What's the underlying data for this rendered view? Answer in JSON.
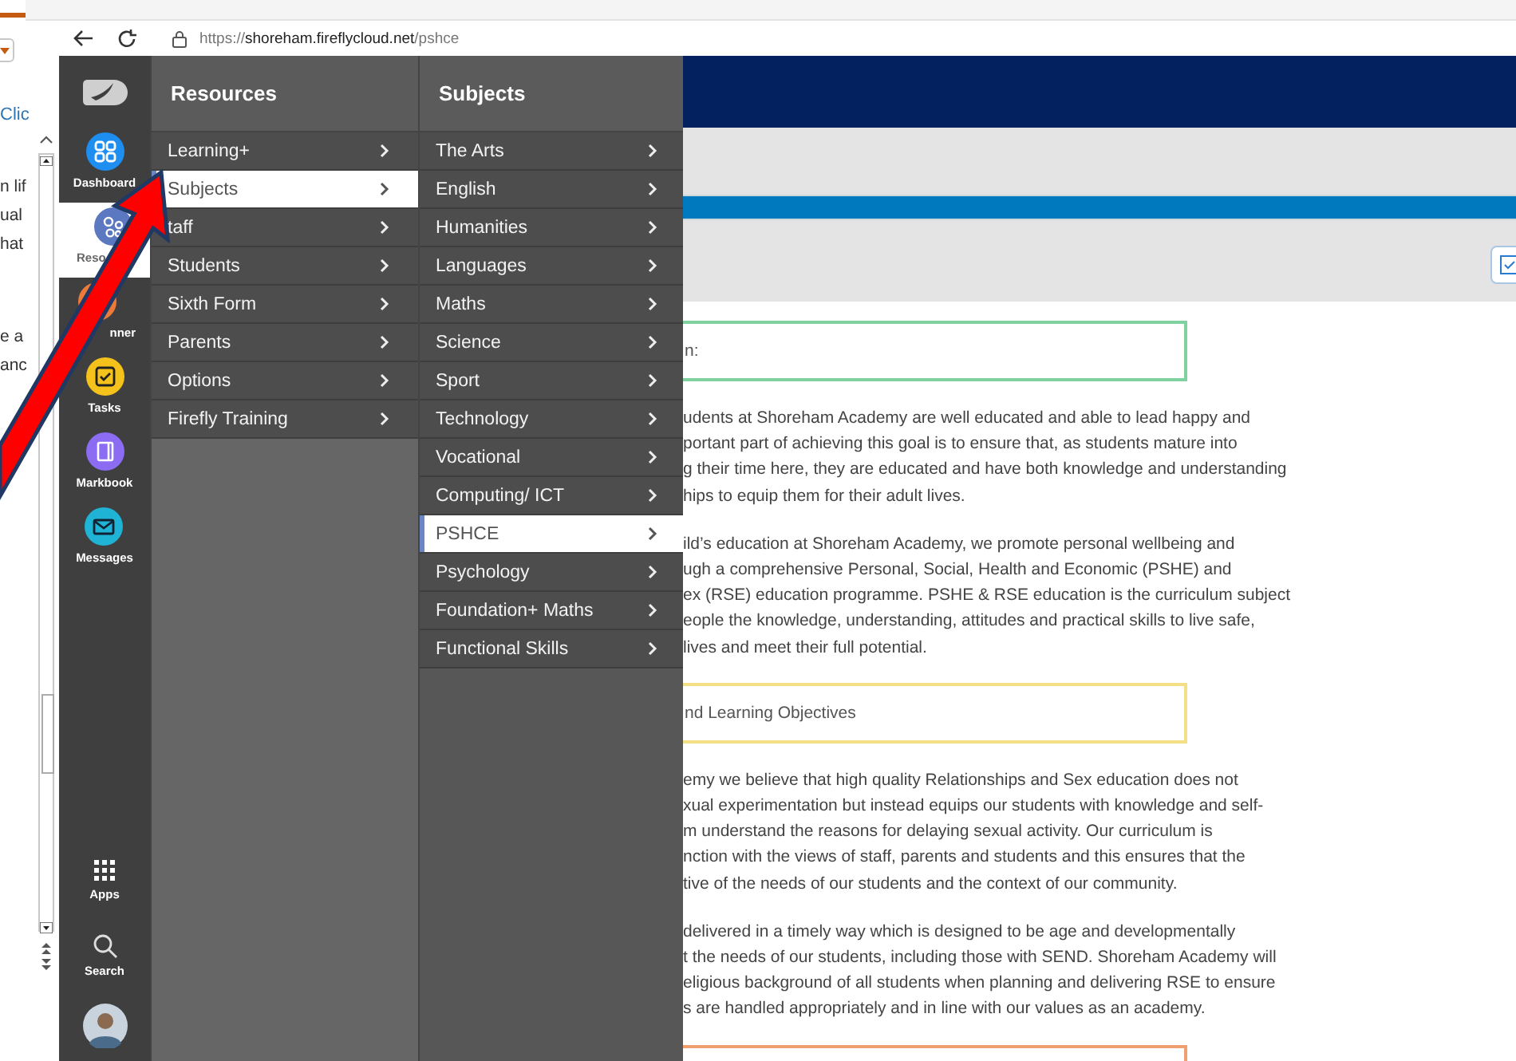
{
  "document_window": {
    "link": "Clic",
    "paragraphs": [
      [
        "n lif",
        "ual",
        "hat"
      ],
      [
        "e a",
        "anc"
      ]
    ]
  },
  "browser": {
    "url": {
      "scheme": "https://",
      "host": "shoreham.fireflycloud.net",
      "path": "/pshce"
    }
  },
  "sidebar": {
    "items": [
      {
        "kind": "dashboard",
        "label": "Dashboard",
        "color": "#1e8ff0",
        "selected": false
      },
      {
        "kind": "resources",
        "label": "Reso",
        "color": "#5b78c0",
        "selected": true,
        "cut_at_end": true
      },
      {
        "kind": "planner",
        "label": "nner",
        "color": "#ee7a3a",
        "selected": false,
        "cut_at_start": true
      },
      {
        "kind": "tasks",
        "label": "Tasks",
        "color": "#f5c21b",
        "selected": false
      },
      {
        "kind": "markbook",
        "label": "Markbook",
        "color": "#8b6cf2",
        "selected": false
      },
      {
        "kind": "messages",
        "label": "Messages",
        "color": "#1fb4d6",
        "selected": false
      }
    ],
    "bottom_items": [
      {
        "kind": "apps",
        "label": "Apps"
      },
      {
        "kind": "search",
        "label": "Search"
      },
      {
        "kind": "avatar"
      }
    ]
  },
  "resources_menu": {
    "title": "Resources",
    "items": [
      {
        "label": "Learning+",
        "selected": false
      },
      {
        "label": "Subjects",
        "selected": true
      },
      {
        "label": "taff",
        "selected": false
      },
      {
        "label": "Students",
        "selected": false
      },
      {
        "label": "Sixth Form",
        "selected": false
      },
      {
        "label": "Parents",
        "selected": false
      },
      {
        "label": "Options",
        "selected": false
      },
      {
        "label": "Firefly Training",
        "selected": false
      }
    ]
  },
  "subjects_menu": {
    "title": "Subjects",
    "items": [
      {
        "label": "The Arts",
        "selected": false
      },
      {
        "label": "English",
        "selected": false
      },
      {
        "label": "Humanities",
        "selected": false
      },
      {
        "label": "Languages",
        "selected": false
      },
      {
        "label": "Maths",
        "selected": false
      },
      {
        "label": "Science",
        "selected": false
      },
      {
        "label": "Sport",
        "selected": false
      },
      {
        "label": "Technology",
        "selected": false
      },
      {
        "label": "Vocational",
        "selected": false
      },
      {
        "label": "Computing/ ICT",
        "selected": false
      },
      {
        "label": "PSHCE",
        "selected": true
      },
      {
        "label": "Psychology",
        "selected": false
      },
      {
        "label": "Foundation+ Maths",
        "selected": false
      },
      {
        "label": "Functional Skills",
        "selected": false
      }
    ]
  },
  "content": {
    "blocks": [
      {
        "kind": "box",
        "color": "#7fd1a0",
        "text": "n:"
      },
      {
        "kind": "paragraph",
        "lines": [
          "udents at Shoreham Academy are well educated and able to lead happy and",
          "portant part of achieving this goal is to ensure that, as students mature into",
          "g their time here, they are educated and have both knowledge and understanding",
          "hips to equip them for their adult lives."
        ]
      },
      {
        "kind": "paragraph",
        "lines": [
          "ild’s education at Shoreham Academy, we promote personal wellbeing and",
          "ugh a comprehensive Personal, Social, Health and Economic (PSHE) and",
          "ex (RSE) education programme. PSHE & RSE education is the curriculum subject",
          "eople the knowledge, understanding, attitudes and practical skills to live safe,",
          "lives and meet their full potential."
        ]
      },
      {
        "kind": "box",
        "color": "#f3df86",
        "text": "nd Learning Objectives"
      },
      {
        "kind": "paragraph",
        "lines": [
          "emy we believe that high quality Relationships and Sex education does not",
          "xual experimentation but instead equips our students with knowledge and self-",
          "m understand the reasons for delaying sexual activity. Our curriculum is",
          "nction with the views of staff, parents and students and this ensures that the",
          "tive of the needs of our students and the context of our community."
        ]
      },
      {
        "kind": "paragraph",
        "lines": [
          "delivered in a timely way which is designed to be age and developmentally",
          "t the needs of our students, including those with SEND. Shoreham Academy will",
          "eligious background of all students when planning and delivering RSE to ensure",
          "s are handled appropriately and in line with our values as an academy."
        ]
      },
      {
        "kind": "box",
        "color": "#f0a070"
      }
    ]
  }
}
